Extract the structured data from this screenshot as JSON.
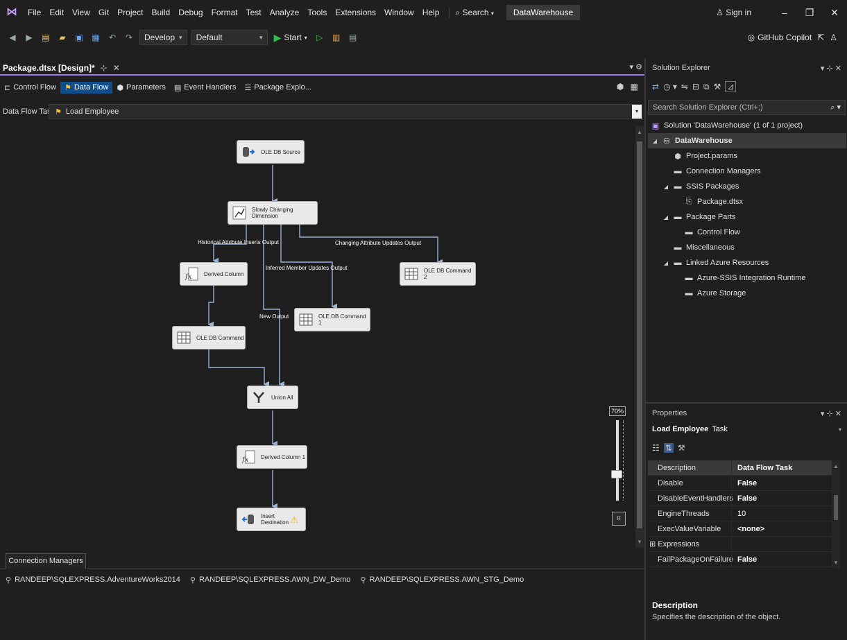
{
  "menu": {
    "items": [
      "File",
      "Edit",
      "View",
      "Git",
      "Project",
      "Build",
      "Debug",
      "Format",
      "Test",
      "Analyze",
      "Tools",
      "Extensions",
      "Window",
      "Help"
    ],
    "search_label": "Search",
    "project_badge": "DataWarehouse",
    "sign_in": "Sign in"
  },
  "toolbar": {
    "config": "Develop",
    "platform": "Default",
    "start_label": "Start",
    "copilot_label": "GitHub Copilot"
  },
  "document_tab": {
    "title": "Package.dtsx [Design]*"
  },
  "designer_tabs": [
    {
      "label": "Control Flow",
      "active": false
    },
    {
      "label": "Data Flow",
      "active": true
    },
    {
      "label": "Parameters",
      "active": false
    },
    {
      "label": "Event Handlers",
      "active": false
    },
    {
      "label": "Package Explo...",
      "active": false
    }
  ],
  "task_row": {
    "label": "Data Flow Task:",
    "selected_task": "Load Employee"
  },
  "canvas": {
    "nodes": [
      {
        "label": "OLE DB Source"
      },
      {
        "label": "Slowly Changing Dimension"
      },
      {
        "label": "Derived Column"
      },
      {
        "label": "OLE DB Command 2"
      },
      {
        "label": "OLE DB Command 1"
      },
      {
        "label": "OLE DB Command"
      },
      {
        "label": "Union All"
      },
      {
        "label": "Derived Column 1"
      },
      {
        "label": "Insert\nDestination"
      }
    ],
    "edge_labels": [
      "Historical Attribute Inserts Output",
      "Changing Attribute Updates Output",
      "Inferred Member Updates Output",
      "New Output"
    ],
    "zoom": "70%"
  },
  "connection_managers": {
    "tab_label": "Connection Managers",
    "items": [
      "RANDEEP\\SQLEXPRESS.AdventureWorks2014",
      "RANDEEP\\SQLEXPRESS.AWN_DW_Demo",
      "RANDEEP\\SQLEXPRESS.AWN_STG_Demo"
    ]
  },
  "solution_explorer": {
    "title": "Solution Explorer",
    "search_placeholder": "Search Solution Explorer (Ctrl+;)",
    "tree": [
      {
        "label": "Solution 'DataWarehouse' (1 of 1 project)"
      },
      {
        "label": "DataWarehouse"
      },
      {
        "label": "Project.params"
      },
      {
        "label": "Connection Managers"
      },
      {
        "label": "SSIS Packages"
      },
      {
        "label": "Package.dtsx"
      },
      {
        "label": "Package Parts"
      },
      {
        "label": "Control Flow"
      },
      {
        "label": "Miscellaneous"
      },
      {
        "label": "Linked Azure Resources"
      },
      {
        "label": "Azure-SSIS Integration Runtime"
      },
      {
        "label": "Azure Storage"
      }
    ]
  },
  "properties": {
    "title": "Properties",
    "object_name": "Load Employee",
    "object_type": "Task",
    "rows": [
      {
        "name": "Description",
        "value": "Data Flow Task"
      },
      {
        "name": "Disable",
        "value": "False"
      },
      {
        "name": "DisableEventHandlers",
        "value": "False"
      },
      {
        "name": "EngineThreads",
        "value": "10"
      },
      {
        "name": "ExecValueVariable",
        "value": "<none>"
      },
      {
        "name": "Expressions",
        "value": ""
      },
      {
        "name": "FailPackageOnFailure",
        "value": "False"
      }
    ],
    "description_title": "Description",
    "description_text": "Specifies the description of the object."
  }
}
